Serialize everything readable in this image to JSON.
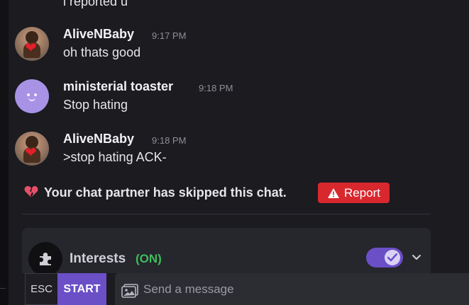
{
  "chat": {
    "partial_previous_text": "i reported u",
    "messages": [
      {
        "author": "AliveNBaby",
        "time": "9:17 PM",
        "text": "oh thats good",
        "avatar": "baby-photo"
      },
      {
        "author": "ministerial toaster",
        "time": "9:18 PM",
        "text": "Stop hating",
        "avatar": "smiley-face"
      },
      {
        "author": "AliveNBaby",
        "time": "9:18 PM",
        "text": ">stop hating ACK-",
        "avatar": "baby-photo"
      }
    ]
  },
  "system_notice": {
    "icon": "broken-heart-icon",
    "text": "Your chat partner has skipped this chat.",
    "report_label": "Report"
  },
  "interests": {
    "label": "Interests",
    "status": "(ON)",
    "enabled": true,
    "icon": "puzzle-icon"
  },
  "composer": {
    "esc_label": "ESC",
    "start_label": "START",
    "placeholder": "Send a message"
  },
  "colors": {
    "background": "#1b1b20",
    "accent": "#6a4fc6",
    "report": "#d8282e",
    "on_status": "#3ebd5c"
  }
}
